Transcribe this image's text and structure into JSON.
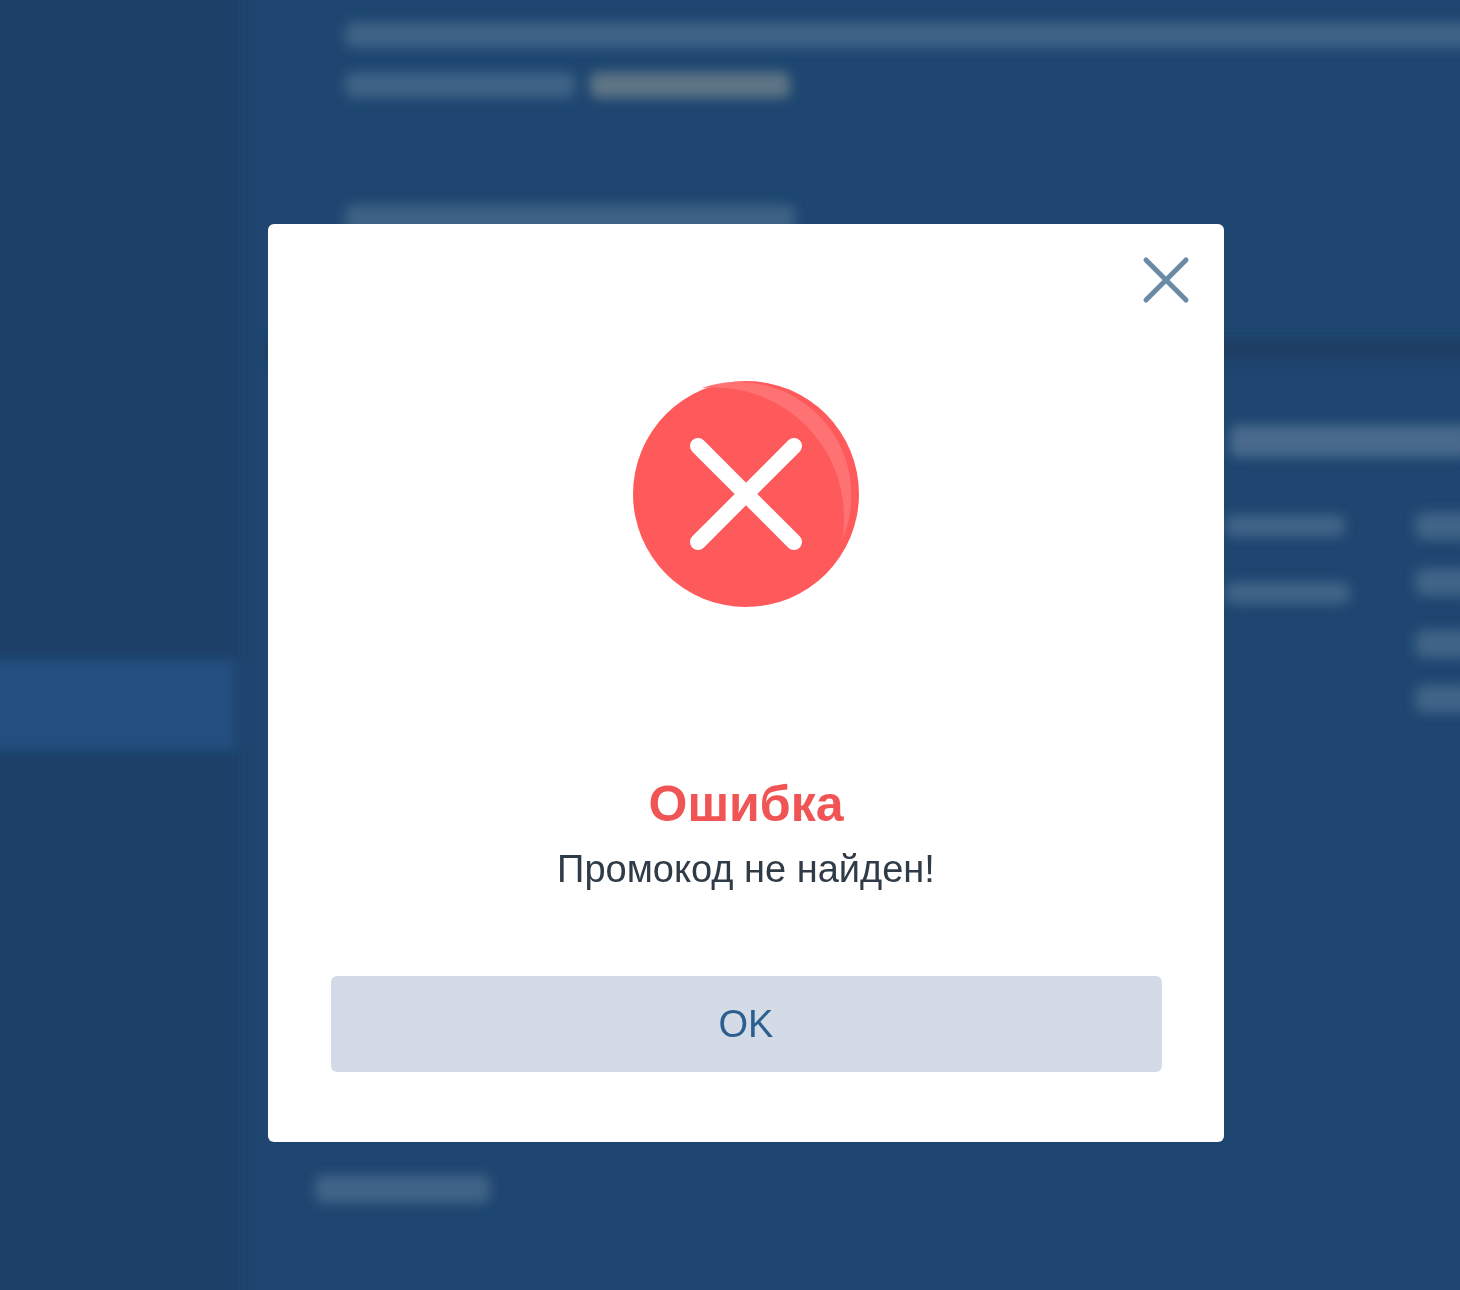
{
  "dialog": {
    "kind": "error",
    "title": "Ошибка",
    "message": "Промокод не найден!",
    "button": "OK"
  }
}
